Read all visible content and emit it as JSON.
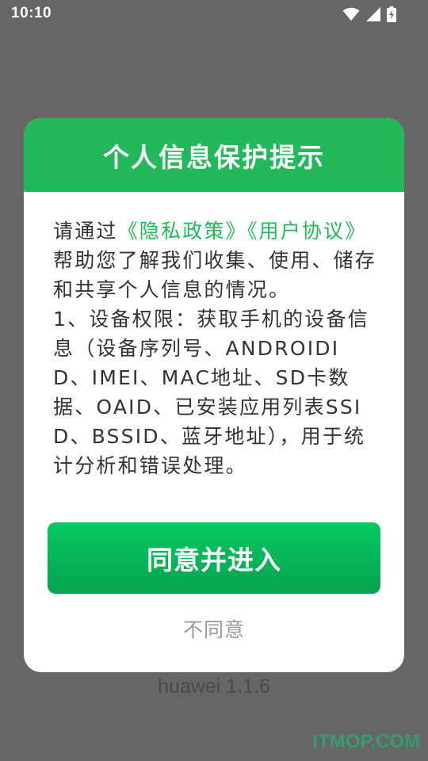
{
  "status_bar": {
    "time": "10:10",
    "icons": [
      "wifi-icon",
      "signal-icon",
      "battery-charging-icon"
    ]
  },
  "dialog": {
    "title": "个人信息保护提示",
    "body": {
      "intro_prefix": "请通过",
      "privacy_policy_link": "《隐私政策》",
      "user_agreement_link": "《用户协议》",
      "intro_suffix": "帮助您了解我们收集、使用、储存和共享个人信息的情况。",
      "item_1": "1、设备权限：获取手机的设备信息（设备序列号、ANDROIDID、IMEI、MAC地址、SD卡数据、OAID、已安装应用列表SSID、BSSID、蓝牙地址），用于统计分析和错误处理。"
    },
    "agree_label": "同意并进入",
    "disagree_label": "不同意"
  },
  "version": "huawei 1.1.6",
  "watermark": "ITMOP.COM",
  "colors": {
    "overlay": "#666666",
    "accent": "#21b95a",
    "button_green": "#07c964",
    "link_green": "#21b95a"
  }
}
